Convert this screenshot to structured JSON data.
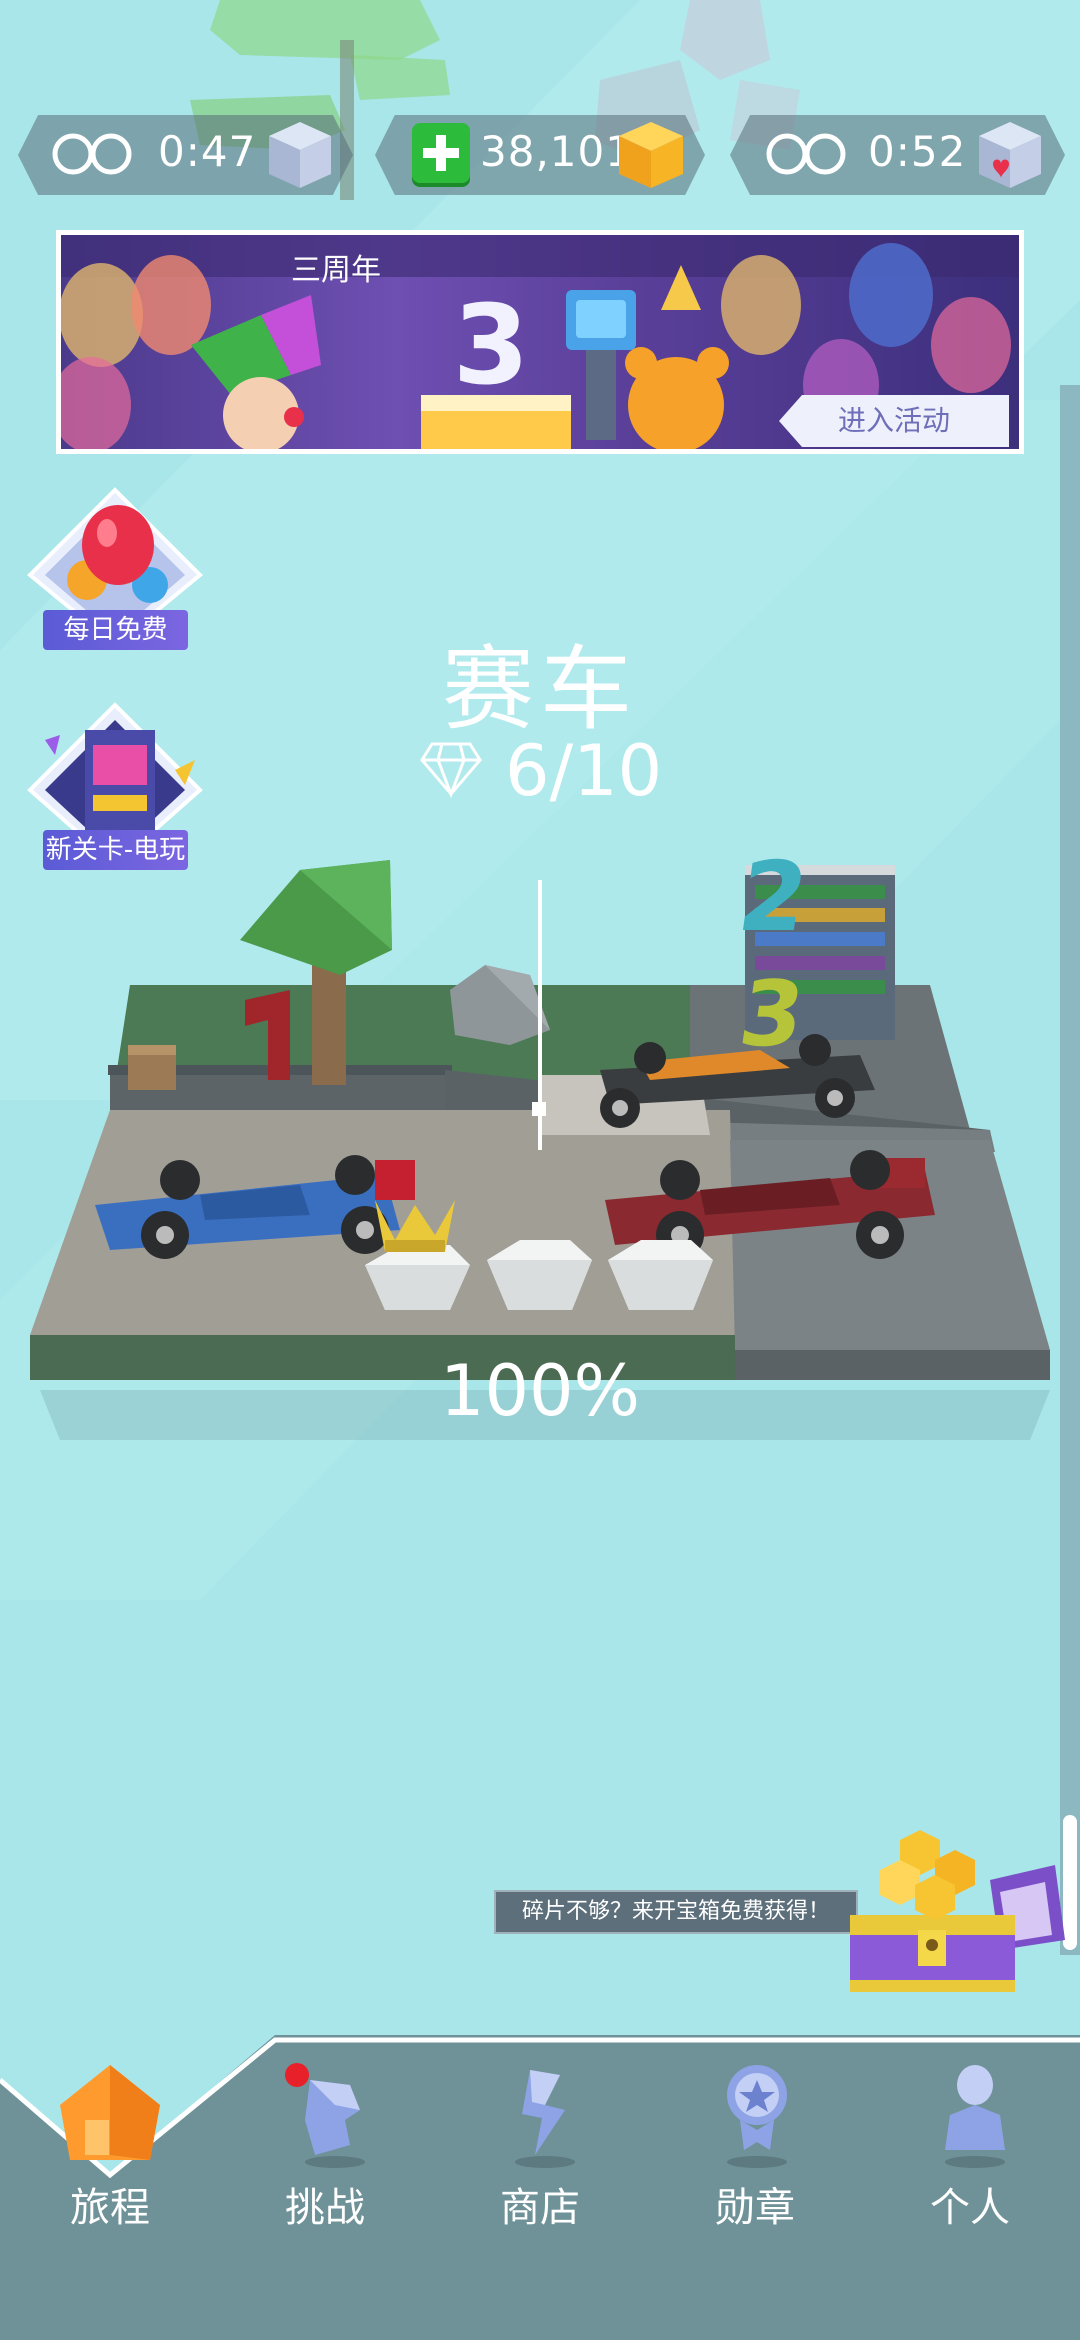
{
  "top_bar": {
    "left_timer": "0:47",
    "coins": "38,101",
    "right_timer": "0:52"
  },
  "banner": {
    "title": "三周年",
    "button": "进入活动"
  },
  "side": {
    "daily_free": "每日免费",
    "new_level": "新关卡-电玩"
  },
  "level": {
    "name": "赛车",
    "gems": "6/10",
    "progress": "100%",
    "progress_value": 100
  },
  "chest": {
    "tip": "碎片不够？来开宝箱免费获得！"
  },
  "nav": {
    "items": [
      "旅程",
      "挑战",
      "商店",
      "勋章",
      "个人"
    ]
  },
  "colors": {
    "background": "#a9e6ea",
    "nav_bg": "#6f9298",
    "accent_orange": "#ff9b2e",
    "coin_gold": "#f7b424",
    "plus_green": "#2dbb3c"
  }
}
